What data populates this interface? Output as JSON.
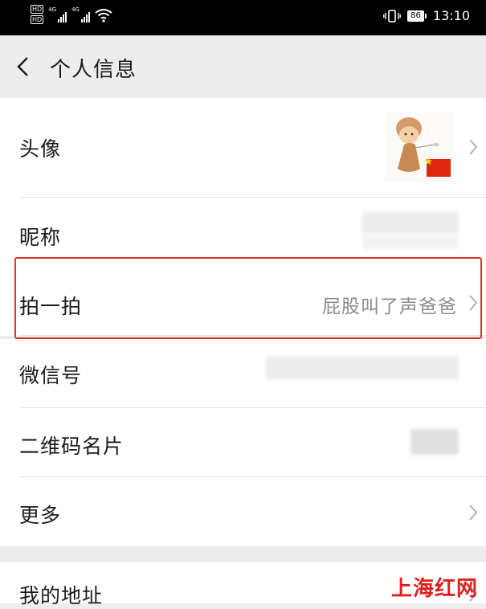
{
  "status_bar": {
    "hd_labels": [
      "HD",
      "HD"
    ],
    "network_labels": [
      "4G",
      "4G"
    ],
    "battery": "86",
    "time": "13:10"
  },
  "nav": {
    "title": "个人信息"
  },
  "rows": [
    {
      "label": "头像",
      "has_arrow": true
    },
    {
      "label": "昵称",
      "has_arrow": false
    },
    {
      "label": "拍一拍",
      "value": "屁股叫了声爸爸",
      "has_arrow": true,
      "highlighted": true
    },
    {
      "label": "微信号",
      "has_arrow": false
    },
    {
      "label": "二维码名片",
      "has_arrow": false
    },
    {
      "label": "更多",
      "has_arrow": true
    },
    {
      "label": "我的地址",
      "has_arrow": true
    }
  ],
  "watermark": "上海红网",
  "colors": {
    "highlight_border": "#d9342b",
    "watermark": "#e01f1f",
    "background": "#ededed",
    "value_text": "#8c8c8c"
  }
}
